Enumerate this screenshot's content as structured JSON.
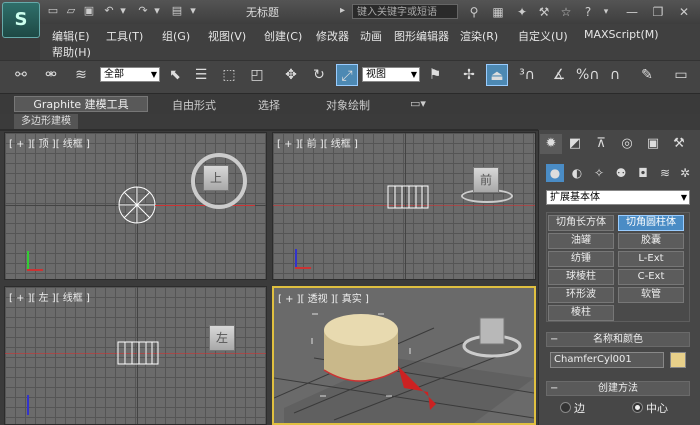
{
  "window": {
    "title": "无标题",
    "logo": "3ds Max"
  },
  "search": {
    "placeholder": "键入关键字或短语"
  },
  "menus": [
    "编辑(E)",
    "工具(T)",
    "组(G)",
    "视图(V)",
    "创建(C)",
    "修改器",
    "动画",
    "图形编辑器",
    "渲染(R)",
    "自定义(U)",
    "MAXScript(M)",
    "帮助(H)"
  ],
  "toolbar": {
    "selection_filter": "全部",
    "ref_coord": "视图"
  },
  "ribbon": {
    "tabs": [
      "Graphite 建模工具",
      "自由形式",
      "选择",
      "对象绘制"
    ],
    "subtab": "多边形建模"
  },
  "viewports": {
    "top": {
      "label": "[ + ][ 顶 ][ 线框 ]",
      "cube": "上"
    },
    "front": {
      "label": "[ + ][ 前 ][ 线框 ]",
      "cube": "前"
    },
    "left": {
      "label": "[ + ][ 左 ][ 线框 ]",
      "cube": "左"
    },
    "persp": {
      "label": "[ + ][ 透视 ][ 真实 ]"
    }
  },
  "command_panel": {
    "category": "扩展基本体",
    "object_types": [
      "切角长方体",
      "切角圆柱体",
      "油罐",
      "胶囊",
      "纺锤",
      "L-Ext",
      "球棱柱",
      "C-Ext",
      "环形波",
      "软管",
      "棱柱"
    ],
    "active_object_type": "切角圆柱体",
    "name_color_header": "名称和颜色",
    "object_name": "ChamferCyl001",
    "object_color": "#e8d08a",
    "creation_method_header": "创建方法",
    "creation_options": [
      "边",
      "中心"
    ],
    "selected_creation_option": "中心"
  },
  "colors": {
    "accent": "#4a8cc5",
    "viewport_bg": "#6b6b6b",
    "active_viewport_border": "#e0c040"
  }
}
